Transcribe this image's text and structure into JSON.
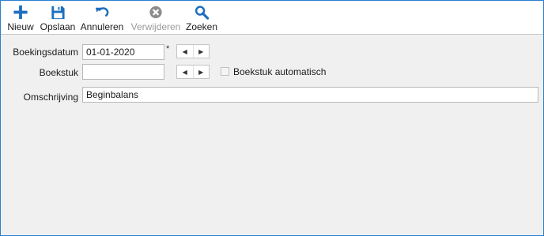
{
  "toolbar": {
    "new_label": "Nieuw",
    "save_label": "Opslaan",
    "cancel_label": "Annuleren",
    "delete_label": "Verwijderen",
    "search_label": "Zoeken"
  },
  "form": {
    "bookingdate_label": "Boekingsdatum",
    "bookingdate_value": "01-01-2020",
    "required_marker": "*",
    "document_label": "Boekstuk",
    "document_value": "",
    "document_auto_label": "Boekstuk automatisch",
    "document_auto_checked": false,
    "description_label": "Omschrijving",
    "description_value": "Beginbalans"
  },
  "colors": {
    "accent": "#1d6fbf",
    "window_border": "#2b7fd0",
    "disabled": "#9a9a9a",
    "background": "#f0f0f0"
  },
  "icons": {
    "new": "plus-icon",
    "save": "floppy-disk-icon",
    "cancel": "undo-icon",
    "delete": "close-circle-icon",
    "search": "magnifier-icon",
    "prev": "arrow-left-icon",
    "next": "arrow-right-icon"
  }
}
